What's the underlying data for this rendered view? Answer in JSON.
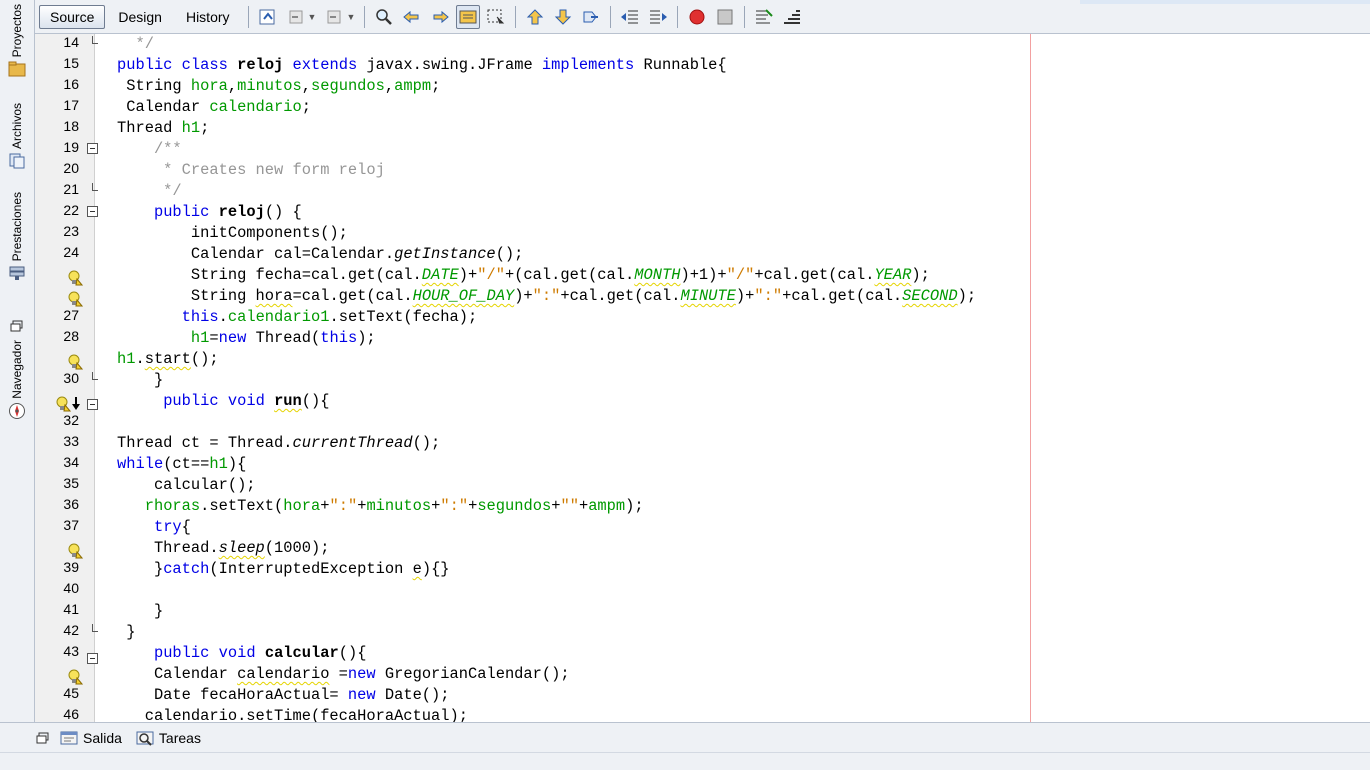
{
  "side_panel": {
    "tabs": [
      {
        "label": "Proyectos",
        "icon": "projects-icon"
      },
      {
        "label": "Archivos",
        "icon": "files-icon"
      },
      {
        "label": "Prestaciones",
        "icon": "services-icon"
      },
      {
        "label": "Navegador",
        "icon": "navigator-icon"
      }
    ]
  },
  "toolbar": {
    "tabs": [
      "Source",
      "Design",
      "History"
    ],
    "active_tab": "Source"
  },
  "editor": {
    "lines": [
      "14",
      "15",
      "16",
      "17",
      "18",
      "19",
      "20",
      "21",
      "22",
      "23",
      "24",
      "",
      "",
      "27",
      "28",
      "",
      "30",
      "",
      "32",
      "33",
      "34",
      "35",
      "36",
      "37",
      "",
      "39",
      "40",
      "41",
      "42",
      "43",
      "",
      "45",
      "46"
    ]
  },
  "bottom_panel": {
    "items": [
      "Salida",
      "Tareas"
    ]
  }
}
